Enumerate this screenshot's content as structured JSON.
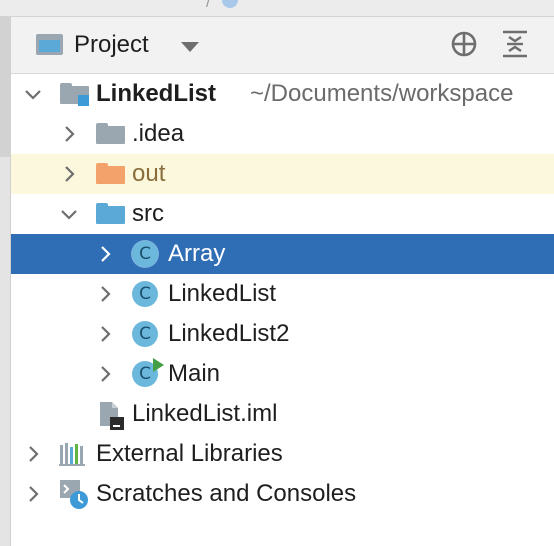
{
  "header": {
    "view_label": "Project"
  },
  "tree": {
    "root": {
      "name": "LinkedList",
      "path": "~/Documents/workspace"
    },
    "items": [
      {
        "label": ".idea"
      },
      {
        "label": "out"
      },
      {
        "label": "src"
      },
      {
        "label": "Array"
      },
      {
        "label": "LinkedList"
      },
      {
        "label": "LinkedList2"
      },
      {
        "label": "Main"
      },
      {
        "label": "LinkedList.iml"
      }
    ],
    "external_libraries": "External Libraries",
    "scratches": "Scratches and Consoles"
  },
  "class_icon_letter": "C",
  "colors": {
    "selection": "#2f6db5",
    "folder_gray": "#9aa7b0",
    "folder_blue": "#5aa9d6",
    "folder_orange": "#f4a26b",
    "class_icon": "#6bb8dc",
    "run_green": "#43a047",
    "excluded_highlight": "#fbf8dd"
  }
}
